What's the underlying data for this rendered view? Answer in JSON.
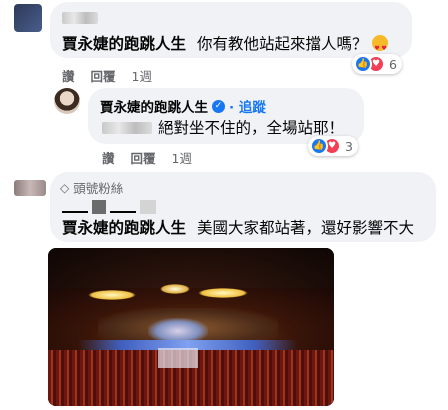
{
  "comment1": {
    "author": "賈永婕的跑跳人生",
    "text": "你有教他站起來擋人嗎？",
    "emoji": "heart-eyes-emoji",
    "actions": {
      "like": "讚",
      "reply": "回覆",
      "time": "1週"
    },
    "reaction_count": "6"
  },
  "reply1": {
    "author": "賈永婕的跑跳人生",
    "follow": "· 追蹤",
    "text": "絕對坐不住的，全場站耶！",
    "actions": {
      "like": "讚",
      "reply": "回覆",
      "time": "1週"
    },
    "reaction_count": "3"
  },
  "comment2": {
    "badge": "頭號粉絲",
    "author": "賈永婕的跑跳人生",
    "text": "美國大家都站著，還好影響不大"
  },
  "colors": {
    "like": "#1877f2",
    "love": "#f33e58",
    "link": "#1877f2",
    "muted": "#65676b",
    "bubble": "#f0f2f5"
  }
}
